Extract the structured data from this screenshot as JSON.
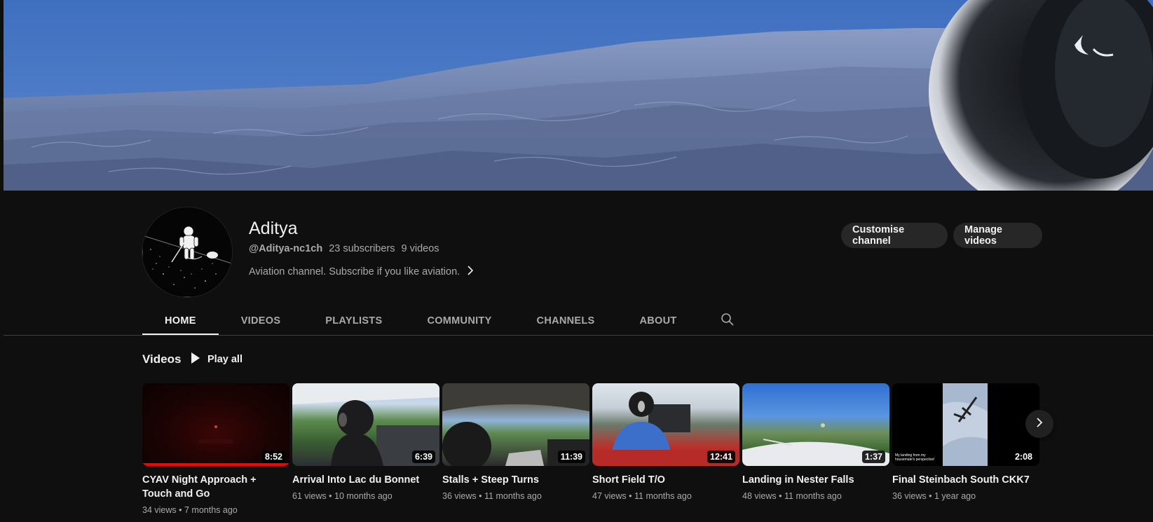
{
  "channel": {
    "name": "Aditya",
    "handle": "@Aditya-nc1ch",
    "subscribers": "23 subscribers",
    "video_count": "9 videos",
    "description": "Aviation channel. Subscribe if you like aviation."
  },
  "actions": {
    "customise": "Customise channel",
    "manage": "Manage videos"
  },
  "tabs": [
    {
      "label": "HOME",
      "active": true
    },
    {
      "label": "VIDEOS",
      "active": false
    },
    {
      "label": "PLAYLISTS",
      "active": false
    },
    {
      "label": "COMMUNITY",
      "active": false
    },
    {
      "label": "CHANNELS",
      "active": false
    },
    {
      "label": "ABOUT",
      "active": false
    }
  ],
  "section": {
    "title": "Videos",
    "play_all": "Play all"
  },
  "videos": [
    {
      "title": "CYAV Night Approach + Touch and Go",
      "duration": "8:52",
      "views": "34 views",
      "age": "7 months ago",
      "watched": 1.0
    },
    {
      "title": "Arrival Into Lac du Bonnet",
      "duration": "6:39",
      "views": "61 views",
      "age": "10 months ago"
    },
    {
      "title": "Stalls + Steep Turns",
      "duration": "11:39",
      "views": "36 views",
      "age": "11 months ago"
    },
    {
      "title": "Short Field T/O",
      "duration": "12:41",
      "views": "47 views",
      "age": "11 months ago"
    },
    {
      "title": "Landing in Nester Falls",
      "duration": "1:37",
      "views": "48 views",
      "age": "11 months ago"
    },
    {
      "title": "Final Steinbach South CKK7",
      "duration": "2:08",
      "views": "36 views",
      "age": "1 year ago",
      "thumb_caption": "My landing from my housemate's perspective!"
    }
  ],
  "meta_separator": "•",
  "icons": {
    "search": "search-icon",
    "play": "play-icon",
    "chevron_right": "chevron-right-icon",
    "next": "chevron-right-icon"
  },
  "colors": {
    "background": "#0f0f0f",
    "button_bg": "#272727",
    "text_secondary": "#aaaaaa",
    "progress": "#ff0000"
  }
}
